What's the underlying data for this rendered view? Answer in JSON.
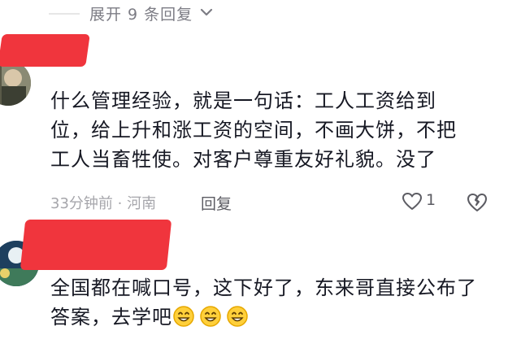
{
  "thread": {
    "expand_label": "展开 9 条回复",
    "expand_icon": "chevron-down-icon"
  },
  "comments": [
    {
      "username": "",
      "text": "什么管理经验，就是一句话：工人工资给到位，给上升和涨工资的空间，不画大饼，不把工人当畜牲使。对客户尊重友好礼貌。没了",
      "time_location": "33分钟前 · 河南",
      "reply_label": "回复",
      "likes": "1"
    },
    {
      "username": "",
      "text": "全国都在喊口号，这下好了，东来哥直接公布了答案，去学吧",
      "emojis": [
        "grin-emoji",
        "grin-emoji",
        "grin-emoji"
      ]
    }
  ],
  "colors": {
    "text": "#161823",
    "muted": "#a6a6ab",
    "redaction": "#f0353d"
  }
}
